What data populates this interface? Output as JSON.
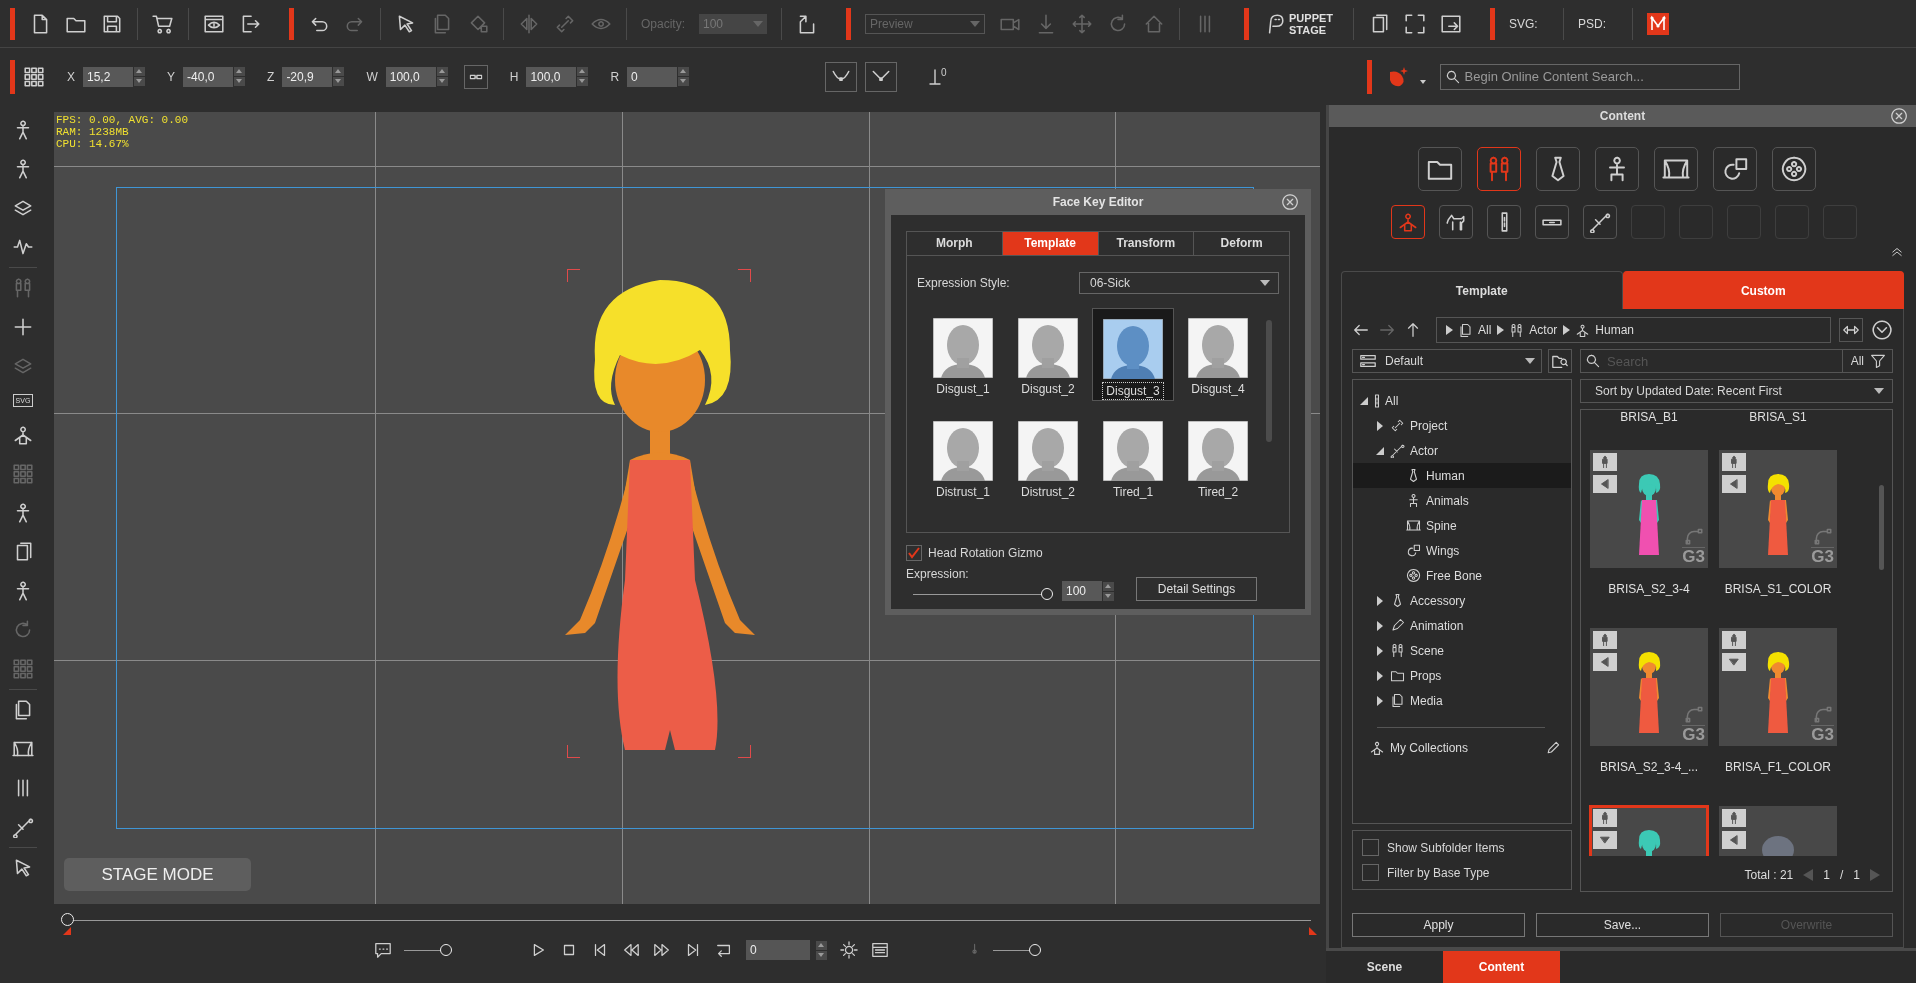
{
  "toolbar": [
    {
      "kind": "accent"
    },
    {
      "kind": "icon",
      "disabled": false
    },
    {
      "kind": "icon",
      "disabled": false
    },
    {
      "kind": "icon",
      "disabled": false
    },
    {
      "kind": "separator"
    },
    {
      "kind": "icon",
      "disabled": false
    },
    {
      "kind": "separator"
    },
    {
      "kind": "icon",
      "disabled": false
    },
    {
      "kind": "icon",
      "disabled": false
    },
    {
      "kind": "accent"
    },
    {
      "kind": "icon",
      "disabled": false
    },
    {
      "kind": "icon",
      "disabled": true
    },
    {
      "kind": "separator"
    },
    {
      "kind": "icon",
      "disabled": false
    },
    {
      "kind": "icon",
      "disabled": true
    },
    {
      "kind": "icon",
      "disabled": true
    },
    {
      "kind": "separator"
    },
    {
      "kind": "icon",
      "disabled": true
    },
    {
      "kind": "icon",
      "disabled": true
    },
    {
      "kind": "icon",
      "disabled": true
    },
    {
      "kind": "separator"
    },
    {
      "kind": "label",
      "text": "Opacity:",
      "disabled": true
    },
    {
      "kind": "field",
      "value": "100",
      "disabled": true
    },
    {
      "kind": "separator"
    },
    {
      "kind": "icon",
      "disabled": false
    },
    {
      "kind": "accent"
    },
    {
      "kind": "dropdown",
      "value": "Preview",
      "disabled": true
    },
    {
      "kind": "icon",
      "disabled": true
    },
    {
      "kind": "icon",
      "disabled": true
    },
    {
      "kind": "icon",
      "disabled": true
    },
    {
      "kind": "icon",
      "disabled": true
    },
    {
      "kind": "icon",
      "disabled": true
    },
    {
      "kind": "separator"
    },
    {
      "kind": "icon",
      "disabled": true
    },
    {
      "kind": "accent"
    },
    {
      "kind": "logo",
      "text": "PUPPET STAGE"
    },
    {
      "kind": "separator"
    },
    {
      "kind": "icon",
      "disabled": false
    },
    {
      "kind": "icon",
      "disabled": false
    },
    {
      "kind": "icon",
      "disabled": false
    },
    {
      "kind": "accent"
    },
    {
      "kind": "label",
      "text": "SVG:",
      "disabled": false
    },
    {
      "kind": "separator"
    },
    {
      "kind": "label",
      "text": "PSD:",
      "disabled": false
    },
    {
      "kind": "separator"
    },
    {
      "kind": "brand"
    }
  ],
  "transform": [
    {
      "label": "X",
      "value": "15,2"
    },
    {
      "label": "Y",
      "value": "-40,0"
    },
    {
      "label": "Z",
      "value": "-20,9"
    },
    {
      "label": "W",
      "value": "100,0"
    },
    {
      "label": "H",
      "value": "100,0"
    },
    {
      "label": "R",
      "value": "0"
    }
  ],
  "axis_label": "0",
  "online_search": {
    "placeholder": "Begin Online Content Search..."
  },
  "sidebar": [
    {
      "disabled": false
    },
    {
      "disabled": false
    },
    {
      "disabled": false
    },
    {
      "disabled": false
    },
    {
      "disabled": true
    },
    {
      "disabled": false
    },
    {
      "disabled": true
    },
    {
      "disabled": false,
      "label": "SVG"
    },
    {
      "disabled": false
    },
    {
      "disabled": true
    },
    {
      "disabled": false
    },
    {
      "disabled": false
    },
    {
      "disabled": false
    },
    {
      "disabled": true
    },
    {
      "disabled": true
    },
    {
      "disabled": false
    },
    {
      "disabled": false
    },
    {
      "disabled": false
    },
    {
      "disabled": false
    },
    {
      "disabled": false
    }
  ],
  "stats": [
    "FPS: 0.00, AVG: 0.00",
    "RAM: 1238MB",
    "CPU: 14.67%"
  ],
  "stage_mode": "STAGE MODE",
  "face_key_editor": {
    "title": "Face Key Editor",
    "tabs": [
      {
        "label": "Morph",
        "selected": false
      },
      {
        "label": "Template",
        "selected": true
      },
      {
        "label": "Transform",
        "selected": false
      },
      {
        "label": "Deform",
        "selected": false
      }
    ],
    "expression_style_label": "Expression Style:",
    "expression_style": "06-Sick",
    "expressions": [
      {
        "name": "Disgust_1",
        "selected": false
      },
      {
        "name": "Disgust_2",
        "selected": false
      },
      {
        "name": "Disgust_3",
        "selected": true
      },
      {
        "name": "Disgust_4",
        "selected": false
      },
      {
        "name": "Distrust_1",
        "selected": false
      },
      {
        "name": "Distrust_2",
        "selected": false
      },
      {
        "name": "Tired_1",
        "selected": false
      },
      {
        "name": "Tired_2",
        "selected": false
      }
    ],
    "head_rotation_gizmo": {
      "label": "Head Rotation Gizmo",
      "checked": true
    },
    "expression": {
      "label": "Expression:",
      "level": 1,
      "value": "100"
    },
    "detail_settings": "Detail Settings"
  },
  "timeline": {
    "level": 0
  },
  "playback": {
    "subtitle_volume": {
      "level": 1
    },
    "frame": "0",
    "audio_volume": {
      "level": 1
    }
  },
  "content": {
    "title": "Content",
    "categories": [
      {
        "selected": false
      },
      {
        "selected": true
      },
      {
        "selected": false
      },
      {
        "selected": false
      },
      {
        "selected": false
      },
      {
        "selected": false
      },
      {
        "selected": false
      }
    ],
    "subcategories": [
      {
        "kind": "icon",
        "selected": true
      },
      {
        "kind": "icon",
        "selected": false
      },
      {
        "kind": "icon",
        "selected": false
      },
      {
        "kind": "icon",
        "selected": false
      },
      {
        "kind": "icon",
        "selected": false
      },
      {
        "kind": "empty"
      },
      {
        "kind": "empty"
      },
      {
        "kind": "empty"
      },
      {
        "kind": "empty"
      },
      {
        "kind": "empty"
      }
    ],
    "tabs": [
      {
        "label": "Template",
        "selected": false
      },
      {
        "label": "Custom",
        "selected": true
      }
    ],
    "breadcrumb": [
      "All",
      "Actor",
      "Human"
    ],
    "library": "Default",
    "search": {
      "placeholder": "Search"
    },
    "filter": "All",
    "sort": "Sort by Updated Date: Recent First",
    "tree": [
      {
        "label": "All",
        "expanded": true,
        "selected": false,
        "children": [
          {
            "label": "Project",
            "expanded": false,
            "selected": false
          },
          {
            "label": "Actor",
            "expanded": true,
            "selected": false,
            "children": [
              {
                "label": "Human",
                "selected": true
              },
              {
                "label": "Animals",
                "selected": false
              },
              {
                "label": "Spine",
                "selected": false
              },
              {
                "label": "Wings",
                "selected": false
              },
              {
                "label": "Free Bone",
                "selected": false
              }
            ]
          },
          {
            "label": "Accessory",
            "expanded": false,
            "selected": false
          },
          {
            "label": "Animation",
            "expanded": false,
            "selected": false
          },
          {
            "label": "Scene",
            "expanded": false,
            "selected": false
          },
          {
            "label": "Props",
            "expanded": false,
            "selected": false
          },
          {
            "label": "Media",
            "expanded": false,
            "selected": false
          }
        ]
      }
    ],
    "my_collections": "My Collections",
    "options": [
      {
        "label": "Show Subfolder Items",
        "checked": false
      },
      {
        "label": "Filter by Base Type",
        "checked": false
      }
    ],
    "items": [
      {
        "name": "BRISA_B1"
      },
      {
        "name": "BRISA_S1"
      },
      {
        "name": "BRISA_S2_3-4",
        "kind": "teal",
        "front": false,
        "badge": "G3",
        "selected": false
      },
      {
        "name": "BRISA_S1_COLOR",
        "kind": "yellow",
        "front": false,
        "badge": "G3",
        "selected": false
      },
      {
        "name": "BRISA_S2_3-4_...",
        "kind": "yellow",
        "front": false,
        "badge": "G3",
        "selected": false
      },
      {
        "name": "BRISA_F1_COLOR",
        "kind": "yellow",
        "front": true,
        "badge": "G3",
        "selected": false
      },
      {
        "kind": "teal",
        "front": true,
        "selected": true
      },
      {
        "kind": "head",
        "front": false,
        "selected": false
      }
    ],
    "total": "Total : 21",
    "page": "1",
    "page_separator": "/",
    "pages": "1",
    "buttons": [
      {
        "label": "Apply",
        "disabled": false
      },
      {
        "label": "Save...",
        "disabled": false
      },
      {
        "label": "Overwrite",
        "disabled": true
      }
    ]
  },
  "bottom_tabs": [
    {
      "label": "Scene",
      "selected": false
    },
    {
      "label": "Content",
      "selected": true
    }
  ]
}
